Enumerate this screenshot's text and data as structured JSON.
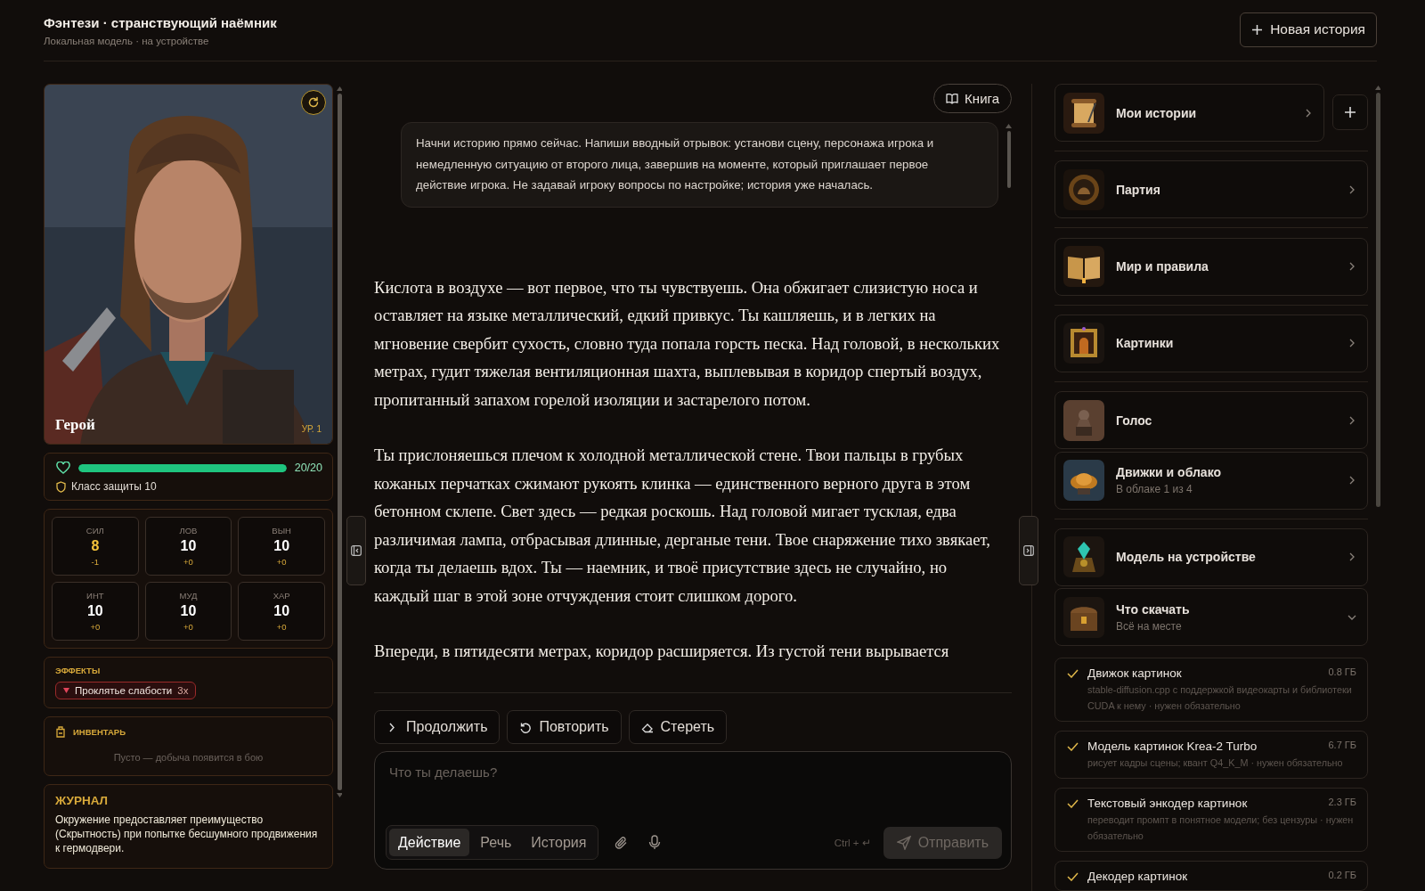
{
  "header": {
    "title": "Фэнтези · странствующий наёмник",
    "subtitle": "Локальная модель · на устройстве",
    "new_button": "Новая история"
  },
  "hero": {
    "name": "Герой",
    "rank": "УР. 1",
    "hp": {
      "level": 1.0,
      "reading": "20/20"
    },
    "armor": "Класс защиты 10",
    "stats": [
      {
        "label": "СИЛ",
        "value": "8",
        "modifier": "-1",
        "penalty": true
      },
      {
        "label": "ЛОВ",
        "value": "10",
        "modifier": "+0",
        "penalty": false
      },
      {
        "label": "ВЫН",
        "value": "10",
        "modifier": "+0",
        "penalty": false
      },
      {
        "label": "ИНТ",
        "value": "10",
        "modifier": "+0",
        "penalty": false
      },
      {
        "label": "МУД",
        "value": "10",
        "modifier": "+0",
        "penalty": false
      },
      {
        "label": "ХАР",
        "value": "10",
        "modifier": "+0",
        "penalty": false
      }
    ],
    "effects": {
      "title": "ЭФФЕКТЫ",
      "items": [
        {
          "name": "Проклятье слабости",
          "count": "3x"
        }
      ]
    },
    "inventory": {
      "title": "ИНВЕНТАРЬ",
      "empty": "Пусто — добыча появится в бою"
    },
    "journal": {
      "title": "ЖУРНАЛ",
      "text": "Окружение предоставляет преимущество (Скрытность) при попытке бесшумного продвижения к гермодвери."
    }
  },
  "story": {
    "book_button": "Книга",
    "prompt": "Начни историю прямо сейчас. Напиши вводный отрывок: установи сцену, персонажа игрока и немедленную ситуацию от второго лица, завершив на моменте, который приглашает первое действие игрока. Не задавай игроку вопросы по настройке; история уже началась.",
    "paragraphs": [
      "Кислота в воздухе — вот первое, что ты чувствуешь. Она обжигает слизистую носа и оставляет на языке металлический, едкий привкус. Ты кашляешь, и в легких на мгновение свербит сухость, словно туда попала горсть песка. Над головой, в нескольких метрах, гудит тяжелая вентиляционная шахта, выплевывая в коридор спертый воздух, пропитанный запахом горелой изоляции и застарелого потом.",
      "Ты прислоняешься плечом к холодной металлической стене. Твои пальцы в грубых кожаных перчатках сжимают рукоять клинка — единственного верного друга в этом бетонном склепе. Свет здесь — редкая роскошь. Над головой мигает тусклая, едва различимая лампа, отбрасывая длинные, дерганые тени. Твое снаряжение тихо звякает, когда ты делаешь вдох. Ты — наемник, и твоё присутствие здесь не случайно, но каждый шаг в этой зоне отчуждения стоит слишком дорого.",
      "Впереди, в пятидесяти метрах, коридор расширяется. Из густой тени вырывается"
    ],
    "actions": [
      {
        "kind": "continue",
        "label": "Продолжить"
      },
      {
        "kind": "retry",
        "label": "Повторить"
      },
      {
        "kind": "erase",
        "label": "Стереть"
      }
    ],
    "input": {
      "placeholder": "Что ты делаешь?",
      "modes": [
        {
          "label": "Действие",
          "selected": true
        },
        {
          "label": "Речь",
          "selected": false
        },
        {
          "label": "История",
          "selected": false
        }
      ],
      "shortcut": "Ctrl + ↵",
      "send": "Отправить",
      "send_disabled": true
    }
  },
  "sidebar": {
    "items": [
      {
        "title": "Мои истории",
        "expanded": false,
        "divider_after": true
      },
      {
        "title": "Партия",
        "expanded": false,
        "divider_after": true
      },
      {
        "title": "Мир и правила",
        "expanded": false,
        "divider_after": true
      },
      {
        "title": "Картинки",
        "expanded": false,
        "divider_after": true
      },
      {
        "title": "Голос",
        "expanded": false,
        "divider_after": false
      },
      {
        "title": "Движки и облако",
        "subtitle": "В облаке 1 из 4",
        "expanded": false,
        "divider_after": true
      },
      {
        "title": "Модель на устройстве",
        "expanded": false,
        "divider_after": false
      },
      {
        "title": "Что скачать",
        "subtitle": "Всё на месте",
        "expanded": true,
        "divider_after": false
      }
    ],
    "downloads": [
      {
        "name": "Движок картинок",
        "size": "0.8 ГБ",
        "note": "stable-diffusion.cpp с поддержкой видеокарты и библиотеки CUDA к нему · нужен обязательно",
        "done": true
      },
      {
        "name": "Модель картинок Krea-2 Turbo",
        "size": "6.7 ГБ",
        "note": "рисует кадры сцены; квант Q4_K_M · нужен обязательно",
        "done": true
      },
      {
        "name": "Текстовый энкодер картинок",
        "size": "2.3 ГБ",
        "note": "переводит промпт в понятное модели; без цензуры · нужен обязательно",
        "done": true
      },
      {
        "name": "Декодер картинок",
        "size": "0.2 ГБ",
        "done": true
      }
    ]
  }
}
